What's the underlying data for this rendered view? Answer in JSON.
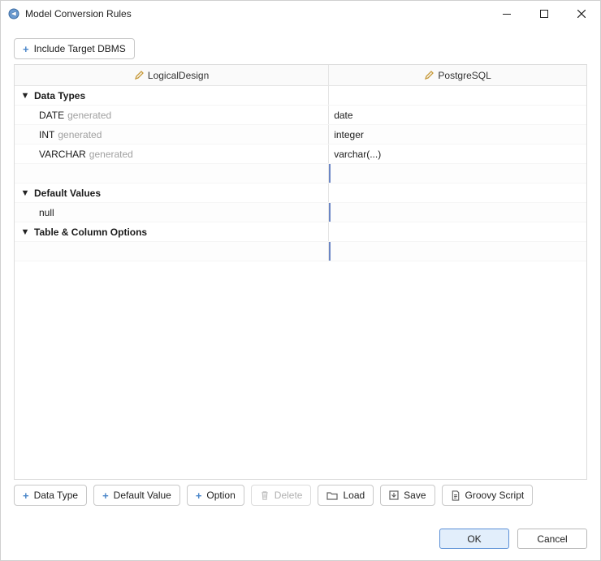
{
  "window": {
    "title": "Model Conversion Rules"
  },
  "top": {
    "include_target_label": "Include Target DBMS"
  },
  "grid": {
    "col_left": "LogicalDesign",
    "col_right": "PostgreSQL",
    "sections": {
      "data_types": "Data Types",
      "default_values": "Default Values",
      "table_col_opts": "Table & Column Options"
    },
    "generated_suffix": "generated",
    "rows": {
      "date": {
        "l": "DATE",
        "r": "date"
      },
      "int": {
        "l": "INT",
        "r": "integer"
      },
      "varchar": {
        "l": "VARCHAR",
        "r": "varchar(...)"
      },
      "null": {
        "l": "null",
        "r": ""
      }
    }
  },
  "actions": {
    "data_type": "Data Type",
    "default_value": "Default Value",
    "option": "Option",
    "delete": "Delete",
    "load": "Load",
    "save": "Save",
    "groovy": "Groovy Script"
  },
  "dialog": {
    "ok": "OK",
    "cancel": "Cancel"
  }
}
